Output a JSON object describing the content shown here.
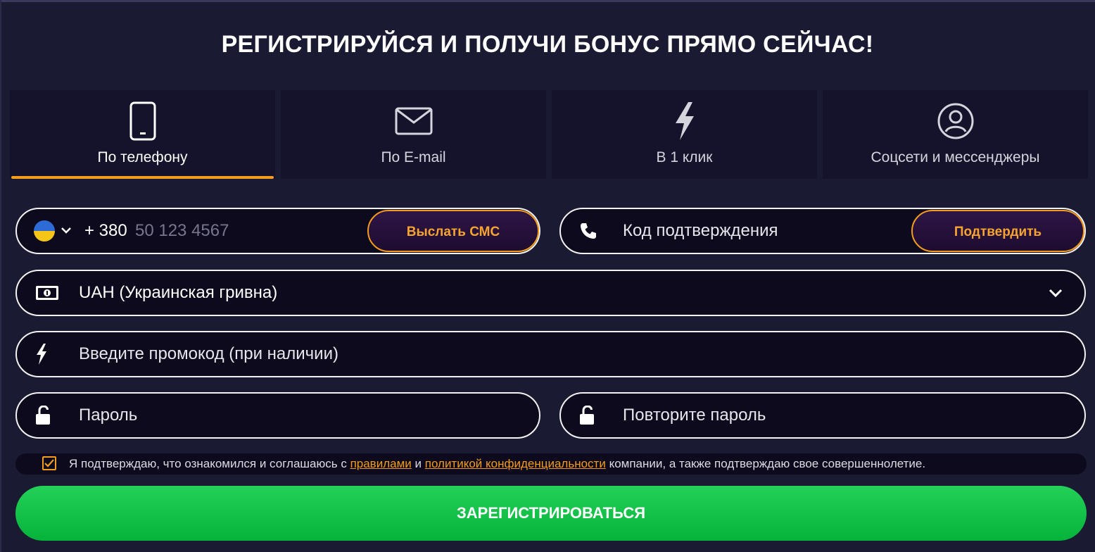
{
  "title": "РЕГИСТРИРУЙСЯ И ПОЛУЧИ БОНУС ПРЯМО СЕЙЧАС!",
  "tabs": [
    {
      "label": "По телефону",
      "icon": "phone-icon",
      "active": true
    },
    {
      "label": "По E-mail",
      "icon": "envelope-icon",
      "active": false
    },
    {
      "label": "В 1 клик",
      "icon": "lightning-icon",
      "active": false
    },
    {
      "label": "Соцсети и мессенджеры",
      "icon": "user-circle-icon",
      "active": false
    }
  ],
  "phone": {
    "country_flag": "ukraine-flag-icon",
    "prefix": "+ 380",
    "placeholder": "50 123 4567",
    "send_sms_label": "Выслать СМС"
  },
  "confirmation": {
    "placeholder": "Код подтверждения",
    "confirm_label": "Подтвердить"
  },
  "currency": {
    "selected": "UAH (Украинская гривна)"
  },
  "promo": {
    "placeholder": "Введите промокод (при наличии)"
  },
  "password": {
    "placeholder": "Пароль",
    "repeat_placeholder": "Повторите пароль"
  },
  "agreement": {
    "checked": true,
    "text_before": "Я подтверждаю, что ознакомился и соглашаюсь с",
    "rules_link": "правилами",
    "and": "и",
    "privacy_link": "политикой конфиденциальности",
    "text_after": "компании, а также подтверждаю свое совершеннолетие."
  },
  "submit_label": "ЗАРЕГИСТРИРОВАТЬСЯ",
  "colors": {
    "background": "#1b1a33",
    "tab_background": "#14132b",
    "accent": "#f39c1d",
    "field_background": "#0c0a1c",
    "submit_green": "#06b33a"
  }
}
